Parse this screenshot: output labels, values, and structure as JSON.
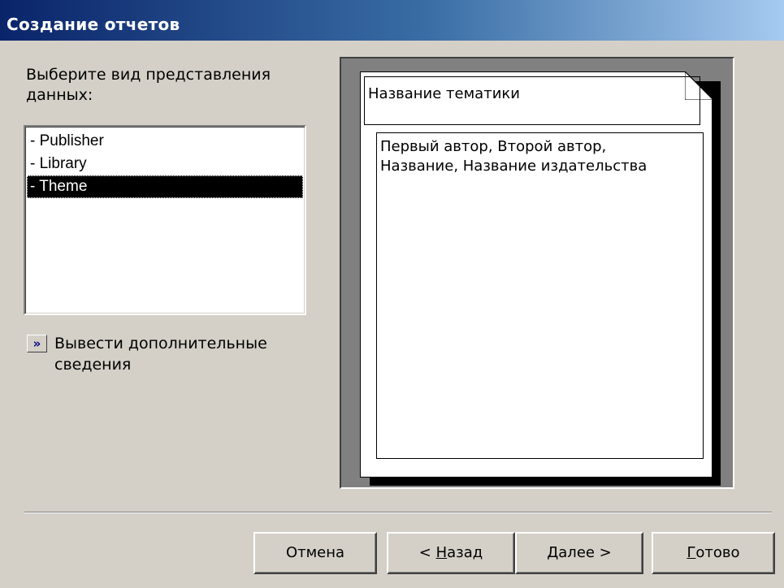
{
  "window": {
    "title": "Создание отчетов"
  },
  "prompt": {
    "text": "Выберите вид представления данных:"
  },
  "views_list": {
    "items": [
      {
        "label": "- Publisher",
        "selected": false
      },
      {
        "label": "- Library",
        "selected": false
      },
      {
        "label": "- Theme",
        "selected": true
      }
    ]
  },
  "more_info": {
    "button_glyph": "»",
    "label": "Вывести дополнительные сведения"
  },
  "preview": {
    "header_text": "Название тематики",
    "detail_line1": "Первый автор, Второй автор,",
    "detail_line2": "Название, Название издательства"
  },
  "buttons": {
    "cancel": "Отмена",
    "back_prefix": "< ",
    "back_hotkey": "Н",
    "back_rest": "азад",
    "next_hotkey": "Д",
    "next_rest": "алее >",
    "finish_hotkey": "Г",
    "finish_rest": "отово"
  },
  "colors": {
    "title_gradient_start": "#0a246a",
    "title_gradient_end": "#a6caf0",
    "dialog_background": "#d4d0c8",
    "selection_background": "#000000",
    "preview_frame": "#808080"
  },
  "icons": {
    "more_button": "double-chevron-right-icon",
    "page_corner": "folded-corner-icon"
  }
}
